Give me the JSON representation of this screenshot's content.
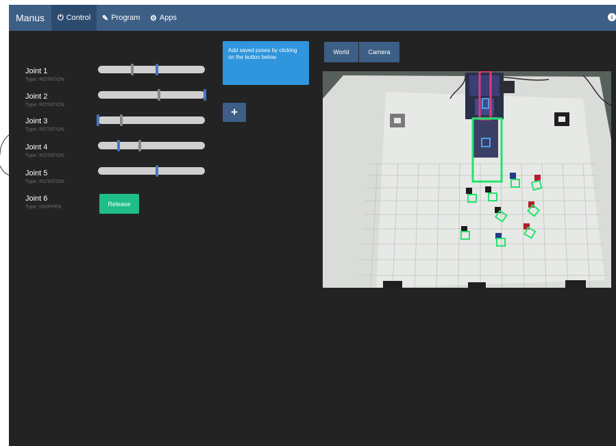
{
  "nav": {
    "brand": "Manus",
    "items": [
      {
        "label": "Control",
        "icon": "power-icon",
        "glyph": "⏻"
      },
      {
        "label": "Program",
        "icon": "pencil-icon",
        "glyph": "✎"
      },
      {
        "label": "Apps",
        "icon": "gear-icon",
        "glyph": "⚙"
      }
    ],
    "info_icon": "i"
  },
  "joints": [
    {
      "label": "Joint 1",
      "type": "Type: ROTATION",
      "value": 0.55,
      "setpoint": 0.32
    },
    {
      "label": "Joint 2",
      "type": "Type: ROTATION",
      "value": 1.0,
      "setpoint": 0.57
    },
    {
      "label": "Joint 3",
      "type": "Type: ROTATION",
      "value": 0.0,
      "setpoint": 0.22
    },
    {
      "label": "Joint 4",
      "type": "Type: ROTATION",
      "value": 0.19,
      "setpoint": 0.39
    },
    {
      "label": "Joint 5",
      "type": "Type: ROTATION",
      "value": 0.55
    },
    {
      "label": "Joint 6",
      "type": "Type: GRIPPER",
      "action": "Release"
    }
  ],
  "poses": {
    "hint": "Add saved poses by clicking on the button below.",
    "add_label": "+"
  },
  "view": {
    "world_label": "World",
    "camera_label": "Camera"
  },
  "colors": {
    "navbar": "#3d5f86",
    "background": "#232323",
    "slider_handle": "#4576c4",
    "release_button": "#1fbd8a",
    "hint_box": "#2f95dd",
    "detection_box": "#22e36a",
    "trajectory": "#e8377c"
  }
}
